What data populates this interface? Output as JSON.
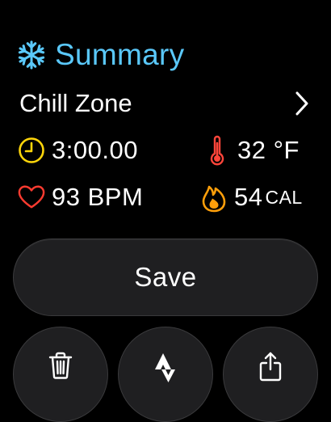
{
  "header": {
    "icon": "snowflake-icon",
    "title": "Summary"
  },
  "zone": {
    "name": "Chill Zone",
    "chevron_icon": "chevron-right-icon"
  },
  "metrics": {
    "duration": {
      "icon": "clock-icon",
      "value": "3:00.00"
    },
    "temperature": {
      "icon": "thermometer-icon",
      "value": "32 °F"
    },
    "heart_rate": {
      "icon": "heart-icon",
      "value": "93 BPM"
    },
    "calories": {
      "icon": "flame-icon",
      "value": "54",
      "unit": "CAL"
    }
  },
  "actions": {
    "save_label": "Save",
    "delete_icon": "trash-icon",
    "strava_icon": "strava-icon",
    "share_icon": "share-icon"
  },
  "colors": {
    "accent_blue": "#5ac8fa",
    "clock_yellow": "#ffd60a",
    "thermo_red": "#ff453a",
    "heart_red": "#ff3b30",
    "flame_orange": "#ff9f0a",
    "button_bg": "#1f1f21"
  }
}
